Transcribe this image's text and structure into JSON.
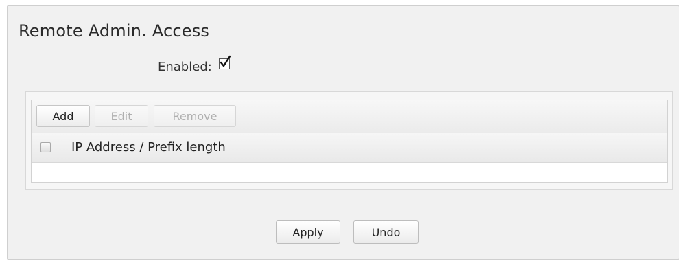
{
  "section": {
    "title": "Remote Admin. Access",
    "enabled_label": "Enabled:",
    "enabled_checked": true
  },
  "toolbar": {
    "add_label": "Add",
    "edit_label": "Edit",
    "remove_label": "Remove",
    "edit_disabled": true,
    "remove_disabled": true
  },
  "table": {
    "columns": [
      "IP Address / Prefix length"
    ],
    "rows": []
  },
  "actions": {
    "apply_label": "Apply",
    "undo_label": "Undo"
  },
  "icons": {
    "enabled_checkbox": "checkbox-checked-icon",
    "select_all_checkbox": "checkbox-unchecked-icon"
  }
}
